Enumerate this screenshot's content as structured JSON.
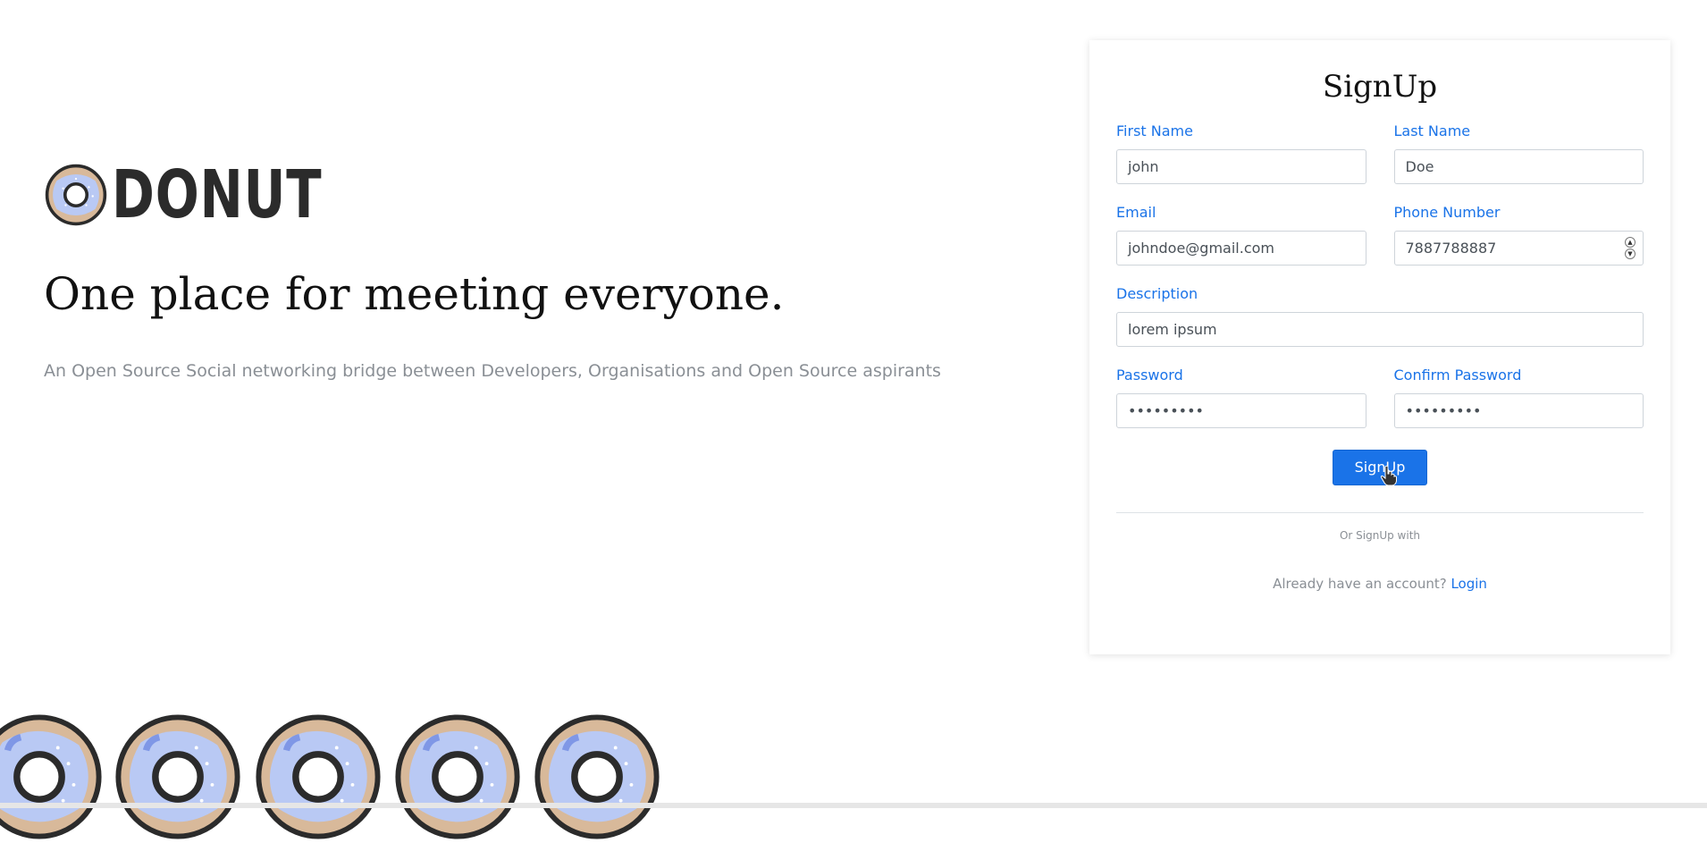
{
  "brand": {
    "name": "DONUT"
  },
  "hero": {
    "tagline": "One place for meeting everyone.",
    "subtext": "An Open Source Social networking bridge between Developers, Organisations and Open Source aspirants"
  },
  "signup": {
    "title": "SignUp",
    "fields": {
      "first_name": {
        "label": "First Name",
        "value": "john"
      },
      "last_name": {
        "label": "Last Name",
        "value": "Doe"
      },
      "email": {
        "label": "Email",
        "value": "johndoe@gmail.com"
      },
      "phone": {
        "label": "Phone Number",
        "value": "7887788887"
      },
      "description": {
        "label": "Description",
        "value": "lorem ipsum"
      },
      "password": {
        "label": "Password",
        "value": "•••••••••"
      },
      "confirm_password": {
        "label": "Confirm Password",
        "value": "•••••••••"
      }
    },
    "submit_label": "SignUp",
    "or_text": "Or SignUp with",
    "login_prompt": "Already have an account?",
    "login_link": "Login"
  },
  "colors": {
    "accent": "#1a73e8",
    "donut_icing": "#b9c9f4",
    "donut_dough": "#d8b99a",
    "donut_outline": "#2b2b2b"
  },
  "icons": {
    "logo": "donut-icon",
    "cursor": "hand-pointer-icon",
    "decor": "donut-icon"
  }
}
